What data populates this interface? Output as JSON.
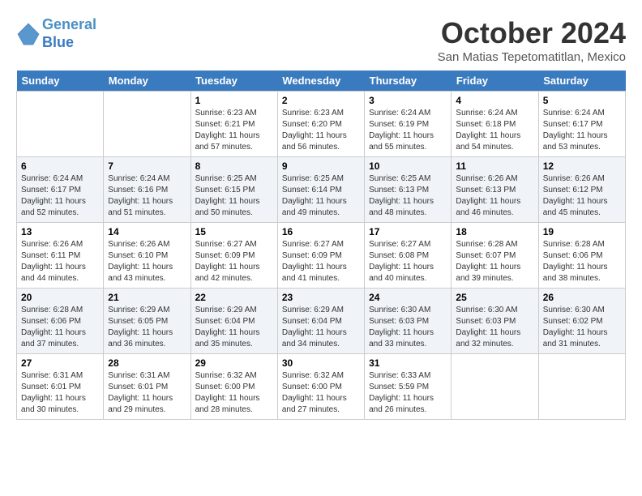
{
  "header": {
    "logo_line1": "General",
    "logo_line2": "Blue",
    "month": "October 2024",
    "location": "San Matias Tepetomatitlan, Mexico"
  },
  "weekdays": [
    "Sunday",
    "Monday",
    "Tuesday",
    "Wednesday",
    "Thursday",
    "Friday",
    "Saturday"
  ],
  "weeks": [
    [
      {
        "day": "",
        "info": ""
      },
      {
        "day": "",
        "info": ""
      },
      {
        "day": "1",
        "info": "Sunrise: 6:23 AM\nSunset: 6:21 PM\nDaylight: 11 hours and 57 minutes."
      },
      {
        "day": "2",
        "info": "Sunrise: 6:23 AM\nSunset: 6:20 PM\nDaylight: 11 hours and 56 minutes."
      },
      {
        "day": "3",
        "info": "Sunrise: 6:24 AM\nSunset: 6:19 PM\nDaylight: 11 hours and 55 minutes."
      },
      {
        "day": "4",
        "info": "Sunrise: 6:24 AM\nSunset: 6:18 PM\nDaylight: 11 hours and 54 minutes."
      },
      {
        "day": "5",
        "info": "Sunrise: 6:24 AM\nSunset: 6:17 PM\nDaylight: 11 hours and 53 minutes."
      }
    ],
    [
      {
        "day": "6",
        "info": "Sunrise: 6:24 AM\nSunset: 6:17 PM\nDaylight: 11 hours and 52 minutes."
      },
      {
        "day": "7",
        "info": "Sunrise: 6:24 AM\nSunset: 6:16 PM\nDaylight: 11 hours and 51 minutes."
      },
      {
        "day": "8",
        "info": "Sunrise: 6:25 AM\nSunset: 6:15 PM\nDaylight: 11 hours and 50 minutes."
      },
      {
        "day": "9",
        "info": "Sunrise: 6:25 AM\nSunset: 6:14 PM\nDaylight: 11 hours and 49 minutes."
      },
      {
        "day": "10",
        "info": "Sunrise: 6:25 AM\nSunset: 6:13 PM\nDaylight: 11 hours and 48 minutes."
      },
      {
        "day": "11",
        "info": "Sunrise: 6:26 AM\nSunset: 6:13 PM\nDaylight: 11 hours and 46 minutes."
      },
      {
        "day": "12",
        "info": "Sunrise: 6:26 AM\nSunset: 6:12 PM\nDaylight: 11 hours and 45 minutes."
      }
    ],
    [
      {
        "day": "13",
        "info": "Sunrise: 6:26 AM\nSunset: 6:11 PM\nDaylight: 11 hours and 44 minutes."
      },
      {
        "day": "14",
        "info": "Sunrise: 6:26 AM\nSunset: 6:10 PM\nDaylight: 11 hours and 43 minutes."
      },
      {
        "day": "15",
        "info": "Sunrise: 6:27 AM\nSunset: 6:09 PM\nDaylight: 11 hours and 42 minutes."
      },
      {
        "day": "16",
        "info": "Sunrise: 6:27 AM\nSunset: 6:09 PM\nDaylight: 11 hours and 41 minutes."
      },
      {
        "day": "17",
        "info": "Sunrise: 6:27 AM\nSunset: 6:08 PM\nDaylight: 11 hours and 40 minutes."
      },
      {
        "day": "18",
        "info": "Sunrise: 6:28 AM\nSunset: 6:07 PM\nDaylight: 11 hours and 39 minutes."
      },
      {
        "day": "19",
        "info": "Sunrise: 6:28 AM\nSunset: 6:06 PM\nDaylight: 11 hours and 38 minutes."
      }
    ],
    [
      {
        "day": "20",
        "info": "Sunrise: 6:28 AM\nSunset: 6:06 PM\nDaylight: 11 hours and 37 minutes."
      },
      {
        "day": "21",
        "info": "Sunrise: 6:29 AM\nSunset: 6:05 PM\nDaylight: 11 hours and 36 minutes."
      },
      {
        "day": "22",
        "info": "Sunrise: 6:29 AM\nSunset: 6:04 PM\nDaylight: 11 hours and 35 minutes."
      },
      {
        "day": "23",
        "info": "Sunrise: 6:29 AM\nSunset: 6:04 PM\nDaylight: 11 hours and 34 minutes."
      },
      {
        "day": "24",
        "info": "Sunrise: 6:30 AM\nSunset: 6:03 PM\nDaylight: 11 hours and 33 minutes."
      },
      {
        "day": "25",
        "info": "Sunrise: 6:30 AM\nSunset: 6:03 PM\nDaylight: 11 hours and 32 minutes."
      },
      {
        "day": "26",
        "info": "Sunrise: 6:30 AM\nSunset: 6:02 PM\nDaylight: 11 hours and 31 minutes."
      }
    ],
    [
      {
        "day": "27",
        "info": "Sunrise: 6:31 AM\nSunset: 6:01 PM\nDaylight: 11 hours and 30 minutes."
      },
      {
        "day": "28",
        "info": "Sunrise: 6:31 AM\nSunset: 6:01 PM\nDaylight: 11 hours and 29 minutes."
      },
      {
        "day": "29",
        "info": "Sunrise: 6:32 AM\nSunset: 6:00 PM\nDaylight: 11 hours and 28 minutes."
      },
      {
        "day": "30",
        "info": "Sunrise: 6:32 AM\nSunset: 6:00 PM\nDaylight: 11 hours and 27 minutes."
      },
      {
        "day": "31",
        "info": "Sunrise: 6:33 AM\nSunset: 5:59 PM\nDaylight: 11 hours and 26 minutes."
      },
      {
        "day": "",
        "info": ""
      },
      {
        "day": "",
        "info": ""
      }
    ]
  ]
}
